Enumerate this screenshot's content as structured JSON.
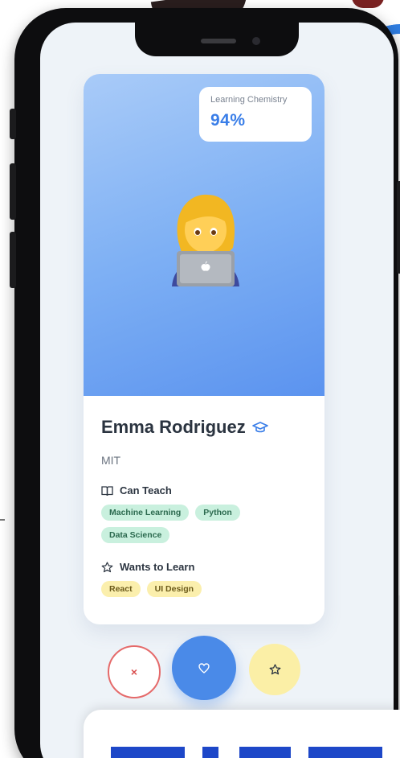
{
  "profile": {
    "chemistry_label": "Learning Chemistry",
    "chemistry_value": "94%",
    "avatar_icon": "woman-technologist-emoji",
    "name": "Emma Rodriguez",
    "name_icon": "graduation-cap-icon",
    "school": "MIT"
  },
  "can_teach": {
    "icon": "book-icon",
    "title": "Can Teach",
    "tags": [
      "Machine Learning",
      "Python",
      "Data Science"
    ]
  },
  "wants_to_learn": {
    "icon": "star-icon",
    "title": "Wants to Learn",
    "tags": [
      "React",
      "UI Design"
    ]
  },
  "actions": {
    "pass_symbol": "×",
    "like_icon": "heart-icon",
    "favorite_icon": "star-icon"
  },
  "colors": {
    "accent": "#4a8ae8",
    "pass": "#e56a6a",
    "teach_tag": "#c9f0de",
    "learn_tag": "#fbefad"
  }
}
